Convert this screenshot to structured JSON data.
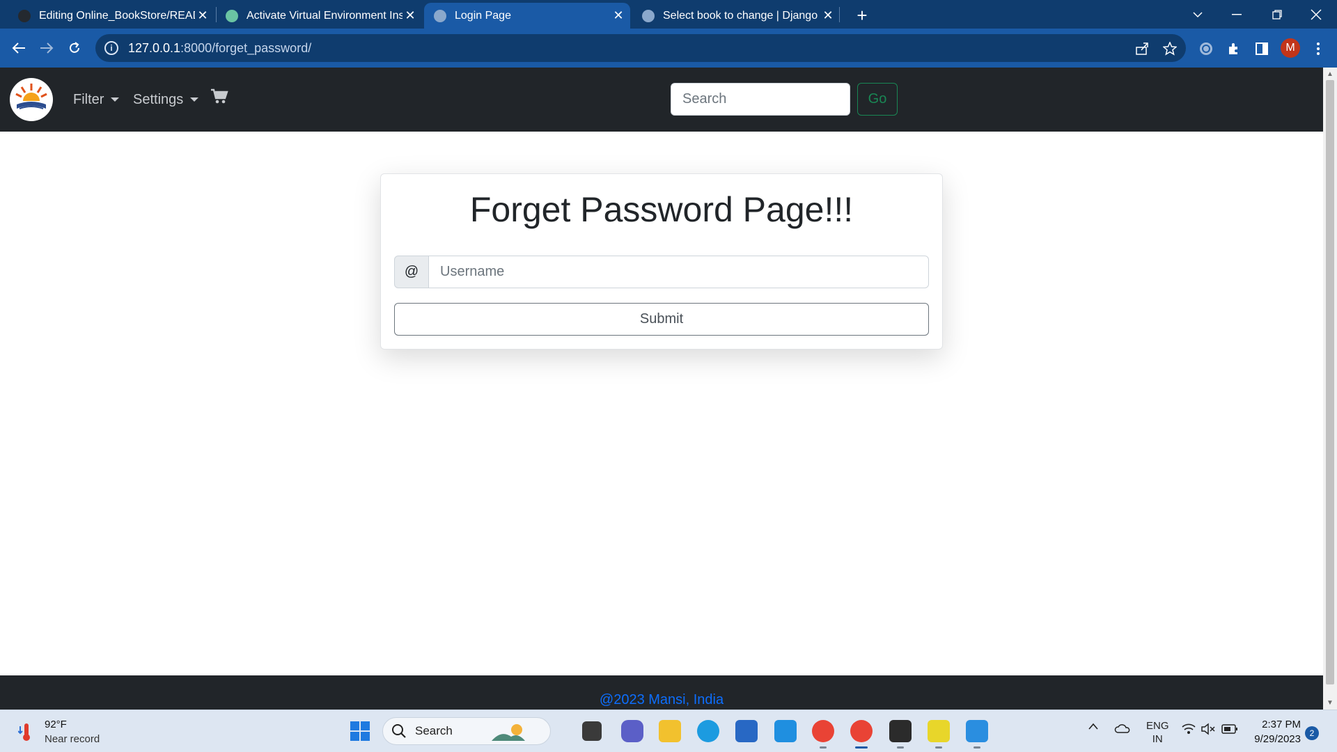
{
  "browser": {
    "tabs": [
      {
        "title": "Editing Online_BookStore/READ",
        "active": false
      },
      {
        "title": "Activate Virtual Environment Ins",
        "active": false
      },
      {
        "title": "Login Page",
        "active": true
      },
      {
        "title": "Select book to change | Django",
        "active": false
      }
    ],
    "url_host": "127.0.0.1",
    "url_path": ":8000/forget_password/"
  },
  "navbar": {
    "filter_label": "Filter",
    "settings_label": "Settings",
    "search_placeholder": "Search",
    "go_label": "Go"
  },
  "card": {
    "title": "Forget Password Page!!!",
    "addon": "@",
    "username_placeholder": "Username",
    "submit_label": "Submit"
  },
  "footer": {
    "text": "@2023 Mansi, India"
  },
  "taskbar": {
    "weather_temp": "92°F",
    "weather_desc": "Near record",
    "search_label": "Search",
    "lang_top": "ENG",
    "lang_bottom": "IN",
    "time": "2:37 PM",
    "date": "9/29/2023",
    "notifications": "2",
    "profile_letter": "M"
  },
  "colors": {
    "tab_strip": "#0f3c6e",
    "toolbar": "#1a5aa6",
    "navbar": "#212529",
    "go_button": "#198754",
    "footer_link": "#0d6efd"
  }
}
